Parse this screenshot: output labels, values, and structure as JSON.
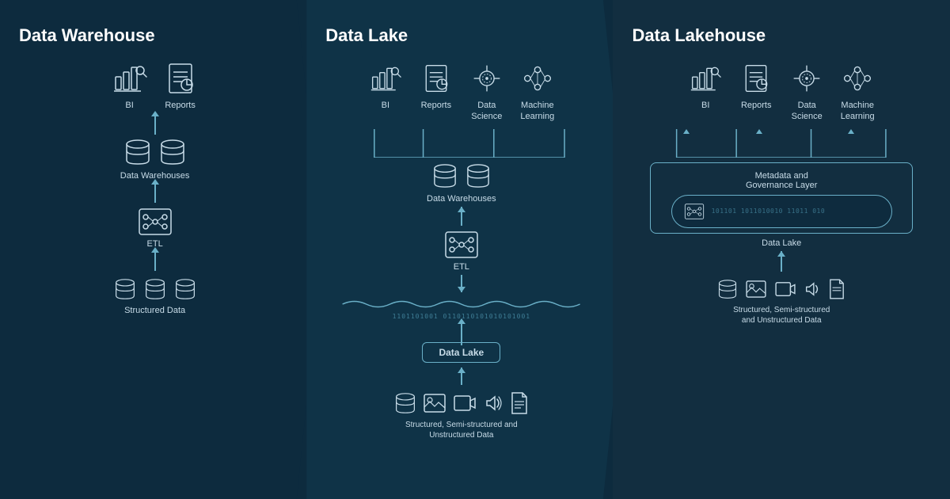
{
  "sections": [
    {
      "id": "warehouse",
      "title": "Data Warehouse",
      "icons_top": [
        {
          "id": "bi",
          "label": "BI"
        },
        {
          "id": "reports",
          "label": "Reports"
        }
      ],
      "nodes": [
        {
          "id": "data-warehouses",
          "label": "Data Warehouses"
        },
        {
          "id": "etl",
          "label": "ETL"
        },
        {
          "id": "structured-data",
          "label": "Structured Data"
        }
      ]
    },
    {
      "id": "lake",
      "title": "Data Lake",
      "icons_top": [
        {
          "id": "bi",
          "label": "BI"
        },
        {
          "id": "reports",
          "label": "Reports"
        },
        {
          "id": "data-science",
          "label": "Data\nScience"
        },
        {
          "id": "machine-learning",
          "label": "Machine\nLearning"
        }
      ],
      "nodes": [
        {
          "id": "data-warehouses",
          "label": "Data Warehouses"
        },
        {
          "id": "etl",
          "label": "ETL"
        },
        {
          "id": "data-lake",
          "label": "Data Lake"
        },
        {
          "id": "structured-semi-unstructured",
          "label": "Structured, Semi-structured and Unstructured Data"
        }
      ]
    },
    {
      "id": "lakehouse",
      "title": "Data Lakehouse",
      "icons_top": [
        {
          "id": "bi",
          "label": "BI"
        },
        {
          "id": "reports",
          "label": "Reports"
        },
        {
          "id": "data-science",
          "label": "Data\nScience"
        },
        {
          "id": "machine-learning",
          "label": "Machine\nLearning"
        }
      ],
      "nodes": [
        {
          "id": "metadata-governance",
          "label": "Metadata and\nGovernance Layer"
        },
        {
          "id": "data-lake",
          "label": "Data Lake"
        },
        {
          "id": "structured-semi-unstructured",
          "label": "Structured, Semi-structured\nand Unstructured Data"
        }
      ]
    }
  ]
}
